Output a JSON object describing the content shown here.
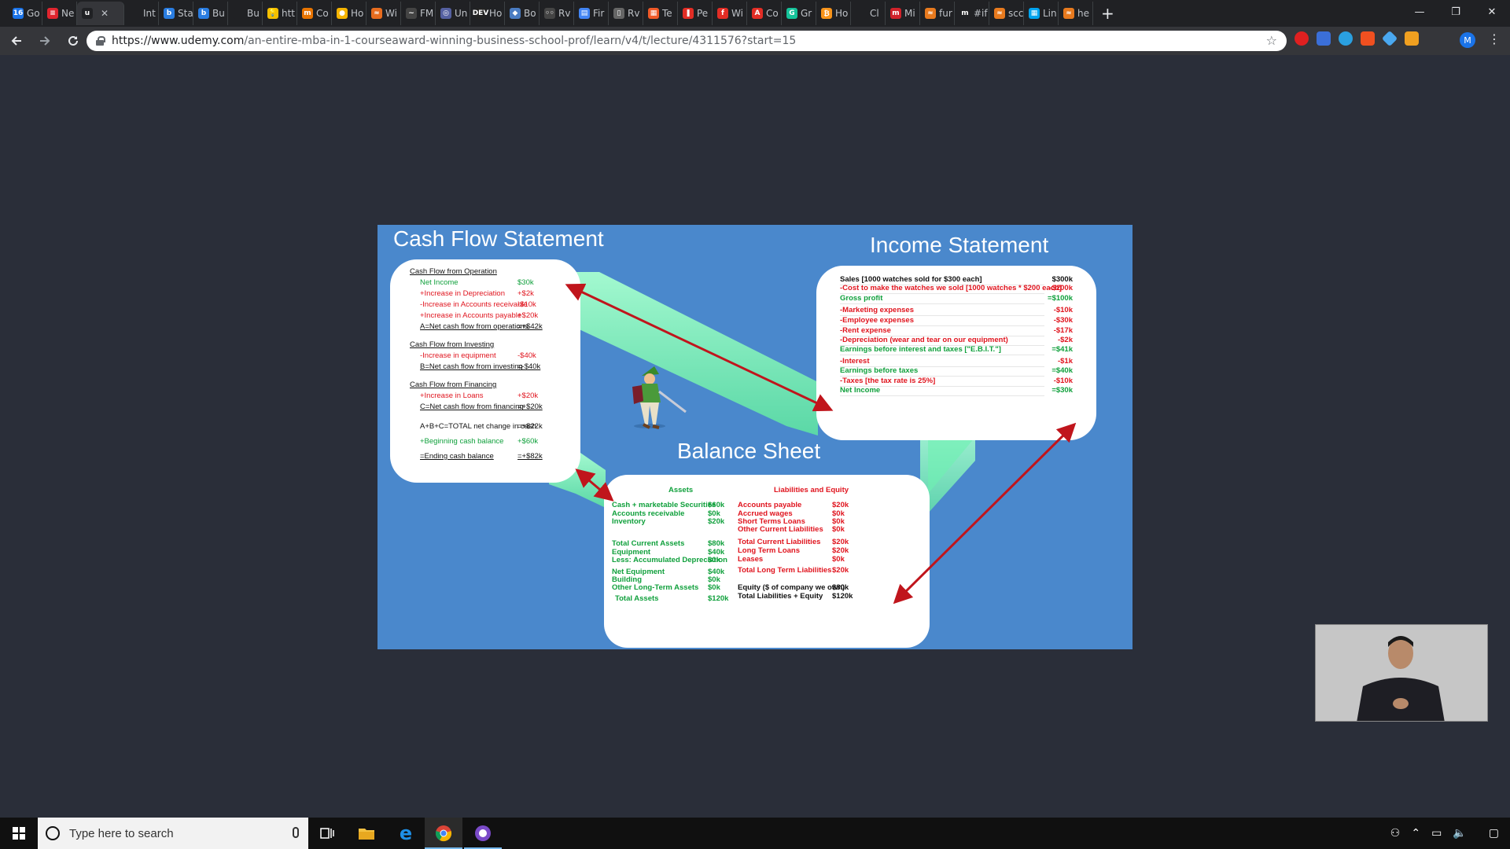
{
  "browser": {
    "tabs": [
      {
        "label": "Go",
        "color": "#1a73e8",
        "glyph": "16"
      },
      {
        "label": "Ne",
        "color": "#e0252f",
        "glyph": "≡"
      },
      {
        "label": "",
        "color": "#202124",
        "glyph": "u",
        "active": true
      },
      {
        "label": "Int",
        "color": "#202124",
        "glyph": ""
      },
      {
        "label": "Sta",
        "color": "#2a7de1",
        "glyph": "b"
      },
      {
        "label": "Bu",
        "color": "#2a7de1",
        "glyph": "b"
      },
      {
        "label": "Bu",
        "color": "#202124",
        "glyph": ""
      },
      {
        "label": "htt",
        "color": "#f6c000",
        "glyph": "💡"
      },
      {
        "label": "Co",
        "color": "#e87400",
        "glyph": "m"
      },
      {
        "label": "Ho",
        "color": "#f5b400",
        "glyph": "●"
      },
      {
        "label": "Wi",
        "color": "#e86c1e",
        "glyph": "≈"
      },
      {
        "label": "FM",
        "color": "#444",
        "glyph": "~"
      },
      {
        "label": "Un",
        "color": "#5560a0",
        "glyph": "◎"
      },
      {
        "label": "Ho",
        "color": "#222",
        "glyph": "DEV"
      },
      {
        "label": "Bo",
        "color": "#4a7cc2",
        "glyph": "◆"
      },
      {
        "label": "Rv",
        "color": "#444",
        "glyph": "◦◦"
      },
      {
        "label": "Fir",
        "color": "#4285f4",
        "glyph": "▤"
      },
      {
        "label": "Rv",
        "color": "#666",
        "glyph": "▯"
      },
      {
        "label": "Te",
        "color": "#f05a28",
        "glyph": "▦"
      },
      {
        "label": "Pe",
        "color": "#e22d25",
        "glyph": "❚"
      },
      {
        "label": "Wi",
        "color": "#e22d25",
        "glyph": "f"
      },
      {
        "label": "Co",
        "color": "#e22d25",
        "glyph": "A"
      },
      {
        "label": "Gr",
        "color": "#15c39a",
        "glyph": "G"
      },
      {
        "label": "Ho",
        "color": "#f7931a",
        "glyph": "₿"
      },
      {
        "label": "Cl",
        "color": "#202124",
        "glyph": ""
      },
      {
        "label": "Mi",
        "color": "#d1222a",
        "glyph": "m"
      },
      {
        "label": "fur",
        "color": "#e87a1e",
        "glyph": "≈"
      },
      {
        "label": "#if",
        "color": "#202124",
        "glyph": "m"
      },
      {
        "label": "scc",
        "color": "#e87a1e",
        "glyph": "≈"
      },
      {
        "label": "Lin",
        "color": "#00a4ef",
        "glyph": "▦"
      },
      {
        "label": "he",
        "color": "#e87a1e",
        "glyph": "≈"
      }
    ],
    "new_tab_label": "+",
    "url_host": "https://www.udemy.com",
    "url_path": "/an-entire-mba-in-1-courseaward-winning-business-school-prof/learn/v4/t/lecture/4311576?start=15",
    "profile_initial": "M",
    "window_controls": [
      "—",
      "❐",
      "✕"
    ]
  },
  "slide": {
    "titles": {
      "cash_flow": "Cash Flow Statement",
      "income": "Income Statement",
      "balance": "Balance Sheet"
    },
    "cash_flow": {
      "sections": [
        {
          "heading": "Cash Flow from Operation",
          "rows": [
            {
              "label": "Net Income",
              "value": "$30k",
              "color": "grn"
            },
            {
              "label": "+Increase in Depreciation",
              "value": "+$2k",
              "color": "red"
            },
            {
              "label": "-Increase in Accounts receivable",
              "value": "-$10k",
              "color": "red"
            },
            {
              "label": "+Increase in Accounts payable",
              "value": "+$20k",
              "color": "red"
            },
            {
              "label": "A=Net cash flow from operations",
              "value": "=+$42k",
              "color": "blk",
              "total": true
            }
          ]
        },
        {
          "heading": "Cash Flow from Investing",
          "rows": [
            {
              "label": "-Increase in equipment",
              "value": "-$40k",
              "color": "red"
            },
            {
              "label": "B=Net cash flow from investing",
              "value": "=-$40k",
              "color": "blk",
              "total": true
            }
          ]
        },
        {
          "heading": "Cash Flow from Financing",
          "rows": [
            {
              "label": "+Increase in Loans",
              "value": "+$20k",
              "color": "red"
            },
            {
              "label": "C=Net cash flow from financing",
              "value": "=+$20k",
              "color": "blk",
              "total": true
            }
          ]
        }
      ],
      "summary": [
        {
          "label": "A+B+C=TOTAL net change in cash",
          "value": "=+$22k",
          "color": "blk"
        },
        {
          "label": "+Beginning cash balance",
          "value": "+$60k",
          "color": "grn"
        },
        {
          "label": "=Ending cash balance",
          "value": "=+$82k",
          "color": "blk",
          "total": true
        }
      ]
    },
    "income": {
      "rows": [
        {
          "label": "Sales [1000 watches sold for $300 each]",
          "value": "$300k",
          "color": "blk"
        },
        {
          "label": "-Cost to make the watches we sold [1000 watches * $200 each]",
          "value": "-$200k",
          "color": "red"
        },
        {
          "label": "Gross profit",
          "value": "=$100k",
          "color": "grn"
        },
        {
          "label": "-Marketing expenses",
          "value": "-$10k",
          "color": "red"
        },
        {
          "label": "-Employee expenses",
          "value": "-$30k",
          "color": "red"
        },
        {
          "label": "-Rent expense",
          "value": "-$17k",
          "color": "red"
        },
        {
          "label": "-Depreciation (wear and tear on our equipment)",
          "value": "-$2k",
          "color": "red"
        },
        {
          "label": "Earnings before interest and taxes [\"E.B.I.T.\"]",
          "value": "=$41k",
          "color": "grn"
        },
        {
          "label": "-Interest",
          "value": "-$1k",
          "color": "red"
        },
        {
          "label": "Earnings before taxes",
          "value": "=$40k",
          "color": "grn"
        },
        {
          "label": "-Taxes [the tax rate is 25%]",
          "value": "-$10k",
          "color": "red"
        },
        {
          "label": "Net Income",
          "value": "=$30k",
          "color": "grn"
        }
      ]
    },
    "balance": {
      "assets_heading": "Assets",
      "liab_heading": "Liabilities and Equity",
      "assets": [
        {
          "label": "Cash + marketable Securities",
          "value": "$60k"
        },
        {
          "label": "Accounts receivable",
          "value": "$0k"
        },
        {
          "label": "Inventory",
          "value": "$20k"
        },
        {
          "label": "Total Current Assets",
          "value": "$80k"
        },
        {
          "label": "Equipment",
          "value": "$40k"
        },
        {
          "label": "Less: Accumulated Depreciation",
          "value": "$0k"
        },
        {
          "label": "Net Equipment",
          "value": "$40k"
        },
        {
          "label": "Building",
          "value": "$0k"
        },
        {
          "label": "Other Long-Term Assets",
          "value": "$0k"
        },
        {
          "label": "Total Assets",
          "value": "$120k"
        }
      ],
      "liabilities": [
        {
          "label": "Accounts payable",
          "value": "$20k",
          "color": "red"
        },
        {
          "label": "Accrued wages",
          "value": "$0k",
          "color": "red"
        },
        {
          "label": "Short Terms Loans",
          "value": "$0k",
          "color": "red"
        },
        {
          "label": "Other Current Liabilities",
          "value": "$0k",
          "color": "red"
        },
        {
          "label": "Total Current Liabilities",
          "value": "$20k",
          "color": "red"
        },
        {
          "label": "Long Term Loans",
          "value": "$20k",
          "color": "red"
        },
        {
          "label": "Leases",
          "value": "$0k",
          "color": "red"
        },
        {
          "label": "Total Long Term Liabilities",
          "value": "$20k",
          "color": "red"
        },
        {
          "label": "Equity ($ of company we own)",
          "value": "$80k",
          "color": "blk"
        },
        {
          "label": "Total Liabilities + Equity",
          "value": "$120k",
          "color": "blk"
        }
      ]
    }
  },
  "taskbar": {
    "search_placeholder": "Type here to search"
  },
  "colors": {
    "slide_bg": "#4a88cc",
    "arrow": "#c0151c",
    "glow": "#7dffb0",
    "green_text": "#10a03c",
    "red_text": "#e0141e"
  }
}
